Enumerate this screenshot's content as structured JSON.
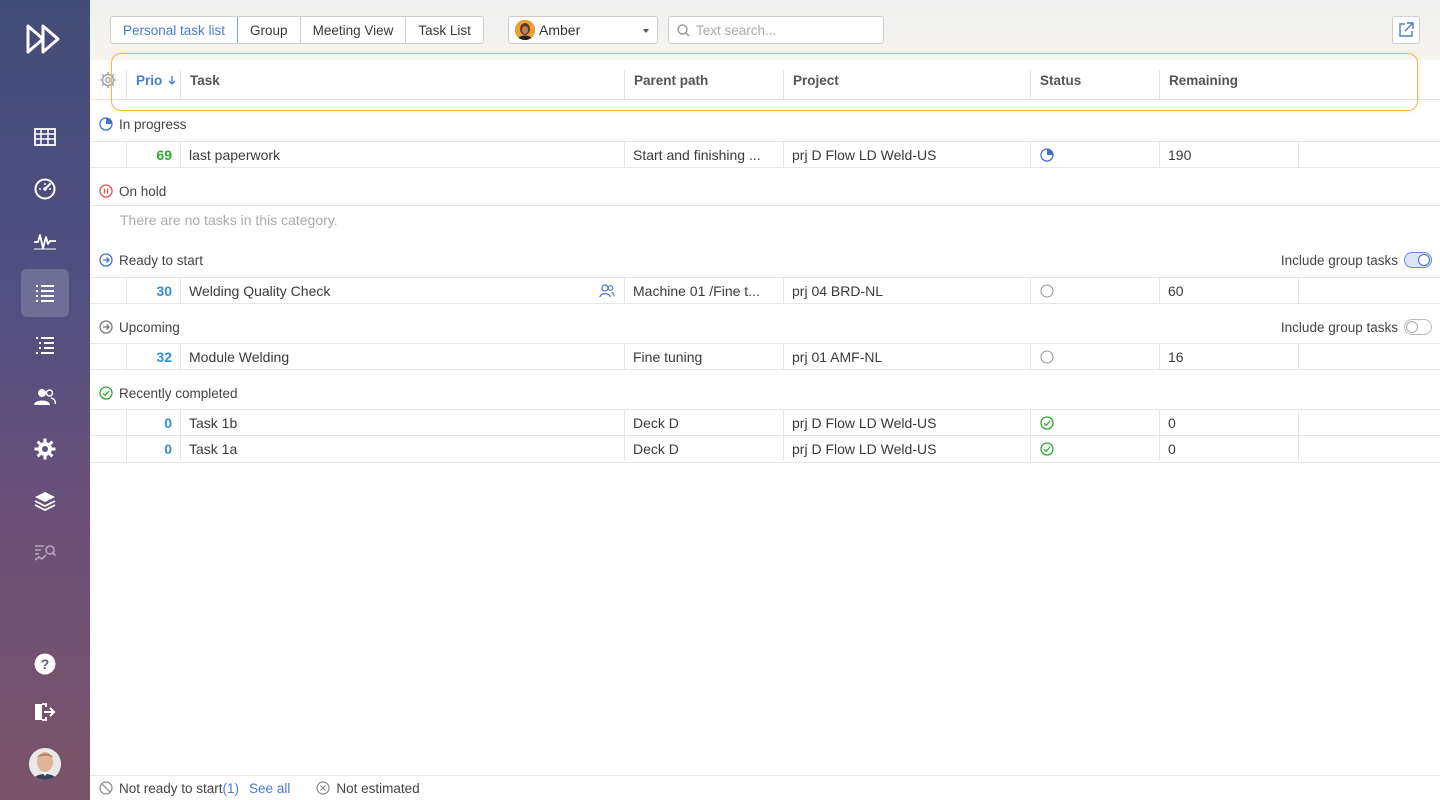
{
  "tabs": [
    {
      "label": "Personal task list",
      "active": true
    },
    {
      "label": "Group",
      "active": false
    },
    {
      "label": "Meeting View",
      "active": false
    },
    {
      "label": "Task List",
      "active": false
    }
  ],
  "user_select": {
    "value": "Amber"
  },
  "search": {
    "placeholder": "Text search..."
  },
  "columns": {
    "prio": "Prio",
    "task": "Task",
    "parent_path": "Parent path",
    "project": "Project",
    "status": "Status",
    "remaining": "Remaining"
  },
  "sections": {
    "in_progress": {
      "label": "In progress"
    },
    "on_hold": {
      "label": "On hold",
      "empty": "There are no tasks in this category."
    },
    "ready": {
      "label": "Ready to start",
      "toggle_label": "Include group tasks",
      "toggle_on": true
    },
    "upcoming": {
      "label": "Upcoming",
      "toggle_label": "Include group tasks",
      "toggle_on": false
    },
    "completed": {
      "label": "Recently completed"
    }
  },
  "rows": {
    "r1": {
      "prio": "69",
      "prio_color": "#2eaa2e",
      "task": "last paperwork",
      "parent": "Start and finishing ...",
      "project": "prj D Flow LD Weld-US",
      "status_icon": "pie-progress-icon",
      "remaining": "190"
    },
    "r2": {
      "prio": "30",
      "prio_color": "#2f8fde",
      "task": "Welding Quality Check",
      "group_icon": "group-users-icon",
      "parent": "Machine 01 /Fine t...",
      "project": "prj 04 BRD-NL",
      "status_icon": "empty-circle-icon",
      "remaining": "60"
    },
    "r3": {
      "prio": "32",
      "prio_color": "#2f8fde",
      "task": "Module Welding",
      "parent": "Fine tuning",
      "project": "prj 01 AMF-NL",
      "status_icon": "empty-circle-icon",
      "remaining": "16"
    },
    "r4": {
      "prio": "0",
      "prio_color": "#2f8fde",
      "task": "Task 1b",
      "parent": "Deck D",
      "project": "prj D Flow LD Weld-US",
      "status_icon": "check-circle-icon",
      "remaining": "0"
    },
    "r5": {
      "prio": "0",
      "prio_color": "#2f8fde",
      "task": "Task 1a",
      "parent": "Deck D",
      "project": "prj D Flow LD Weld-US",
      "status_icon": "check-circle-icon",
      "remaining": "0"
    }
  },
  "footer": {
    "not_ready_label": "Not ready to start",
    "not_ready_count": "(1)",
    "see_all": "See all",
    "not_estimated": "Not estimated"
  },
  "colors": {
    "accent": "#4a7bd0",
    "highlight": "#f2b843",
    "green": "#2eaa2e",
    "red": "#e05050"
  }
}
